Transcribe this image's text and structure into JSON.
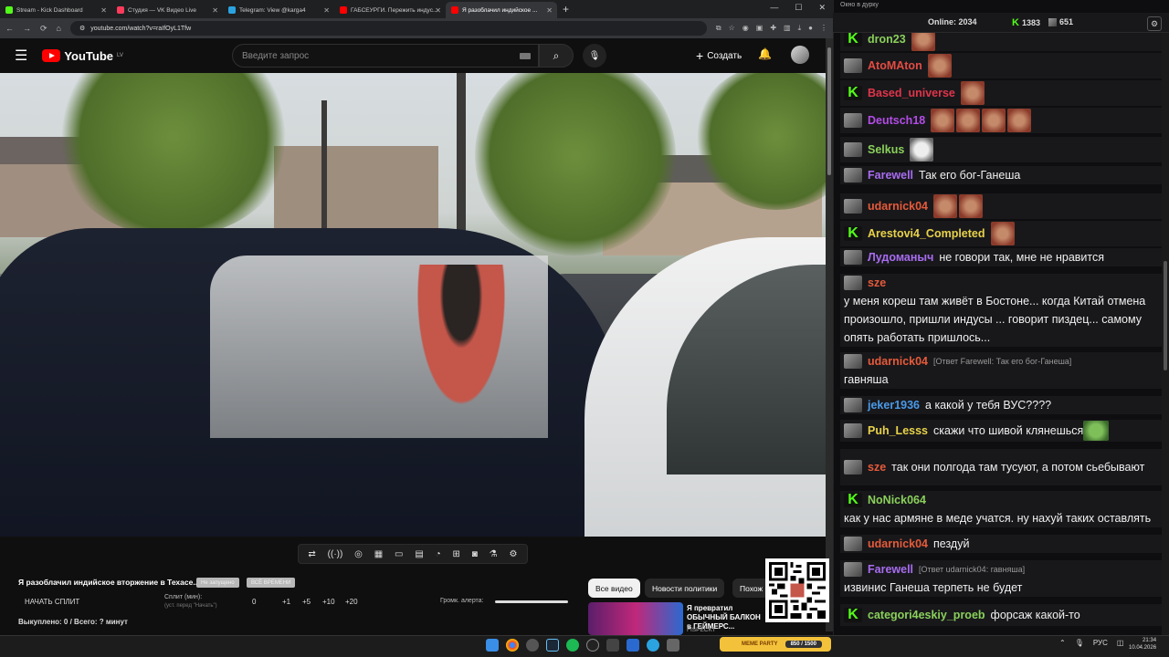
{
  "browser": {
    "tabs": [
      {
        "title": "Stream - Kick Dashboard",
        "color": "#53fc18"
      },
      {
        "title": "Студия — VK Видео Live",
        "color": "#ff3b5c"
      },
      {
        "title": "Telegram: View @karga4",
        "color": "#2aa3e0"
      },
      {
        "title": "ГАБСЕУРГИ. Пережить индус...",
        "color": "#ff0000"
      },
      {
        "title": "Я разоблачил индийское ...",
        "color": "#ff0000",
        "active": true
      }
    ],
    "url": "youtube.com/watch?v=raIfOyL1Tfw"
  },
  "youtube": {
    "logo": "YouTube",
    "region": "LV",
    "search_placeholder": "Введите запрос",
    "create_label": "Создать"
  },
  "controls": {
    "stream_title": "Я разоблачил индийское вторжение в Техасе...",
    "pill1": "Не запущено",
    "pill2": "ВСЁ ВРЕМЕНИ",
    "start_split": "НАЧАТЬ СПЛИТ",
    "split_label": "Сплит (мин):",
    "split_sub": "(уст. перед \"Начать\")",
    "split_values": [
      "0",
      "+1",
      "+5",
      "+10",
      "+20"
    ],
    "alert_label": "Громк. алерта:",
    "alert_volume": 1.0,
    "bought": "Выкуплено: 0 / Всего: ? минут"
  },
  "chips": [
    "Все видео",
    "Новости политики",
    "Похож"
  ],
  "recommendation": {
    "title": "Я превратил ОБЫЧНЫЙ БАЛКОН в ГЕЙМЕРС...",
    "channel": "FISPECKT"
  },
  "chat_window": {
    "title": "Окно в дурку",
    "online_label": "Online:",
    "online_count": "2034",
    "kick_count": "1383",
    "other_count": "651"
  },
  "chat": [
    {
      "badge": "k",
      "name": "dron23",
      "color": "#8ad05a",
      "text": "",
      "emotes": 1
    },
    {
      "badge": "a",
      "name": "AtoMAton",
      "color": "#e34c42",
      "text": "",
      "emotes": 1
    },
    {
      "badge": "k",
      "name": "Based_universe",
      "color": "#e0354a",
      "text": "",
      "emotes": 1
    },
    {
      "badge": "a",
      "name": "Deutsch18",
      "color": "#b34ce6",
      "text": "",
      "emotes": 4
    },
    {
      "badge": "a",
      "name": "Selkus",
      "color": "#8ad05a",
      "text": "",
      "emotes": 1,
      "emote_type": "cat"
    },
    {
      "badge": "a",
      "name": "Farewell",
      "color": "#a86cf0",
      "text": "Так его бог-Ганеша"
    },
    {
      "badge": "a",
      "name": "udarnick04",
      "color": "#e55a3a",
      "text": "",
      "emotes": 2
    },
    {
      "badge": "k",
      "name": "Arestovi4_Completed",
      "color": "#e8d24a",
      "text": "",
      "emotes": 1
    },
    {
      "badge": "a",
      "name": "Лудоманыч",
      "color": "#a86cf0",
      "text": "не говори так, мне не нравится"
    },
    {
      "badge": "a",
      "name": "sze",
      "color": "#e55a3a",
      "text": "у меня кореш там живёт в Бостоне... когда Китай отмена произошло, пришли индусы ... говорит пиздец... самому опять работать пришлось..."
    },
    {
      "badge": "a",
      "name": "udarnick04",
      "color": "#e55a3a",
      "reply": "[Ответ Farewell: Так его бог-Ганеша]",
      "text": "гавняша"
    },
    {
      "badge": "a",
      "name": "jeker1936",
      "color": "#4a9ae8",
      "text": "а какой у тебя ВУС????"
    },
    {
      "badge": "a",
      "name": "Puh_Lesss",
      "color": "#e8d24a",
      "text": "скажи что шивой клянешься",
      "emotes": 1,
      "emote_type": "pepe"
    },
    {
      "badge": "a",
      "name": "sze",
      "color": "#e55a3a",
      "text": "так они полгода там тусуют, а потом сьебывают"
    },
    {
      "badge": "k",
      "name": "NoNick064",
      "color": "#8ad05a",
      "text": "как у нас армяне в меде учатся. ну нахуй таких оставлять"
    },
    {
      "badge": "a",
      "name": "udarnick04",
      "color": "#e55a3a",
      "text": "пездуй"
    },
    {
      "badge": "a",
      "name": "Farewell",
      "color": "#a86cf0",
      "reply": "[Ответ udarnick04: гавняша]",
      "text": "извинис Ганеша терпеть не будет"
    },
    {
      "badge": "k",
      "name": "categori4eskiy_proeb",
      "color": "#8ad05a",
      "text": "форсаж какой-то"
    }
  ],
  "taskbar": {
    "meme_label": "MEME PARTY",
    "meme_count": "850 / 1500",
    "lang": "РУС",
    "time": "21:34",
    "date": "10.04.2026"
  }
}
